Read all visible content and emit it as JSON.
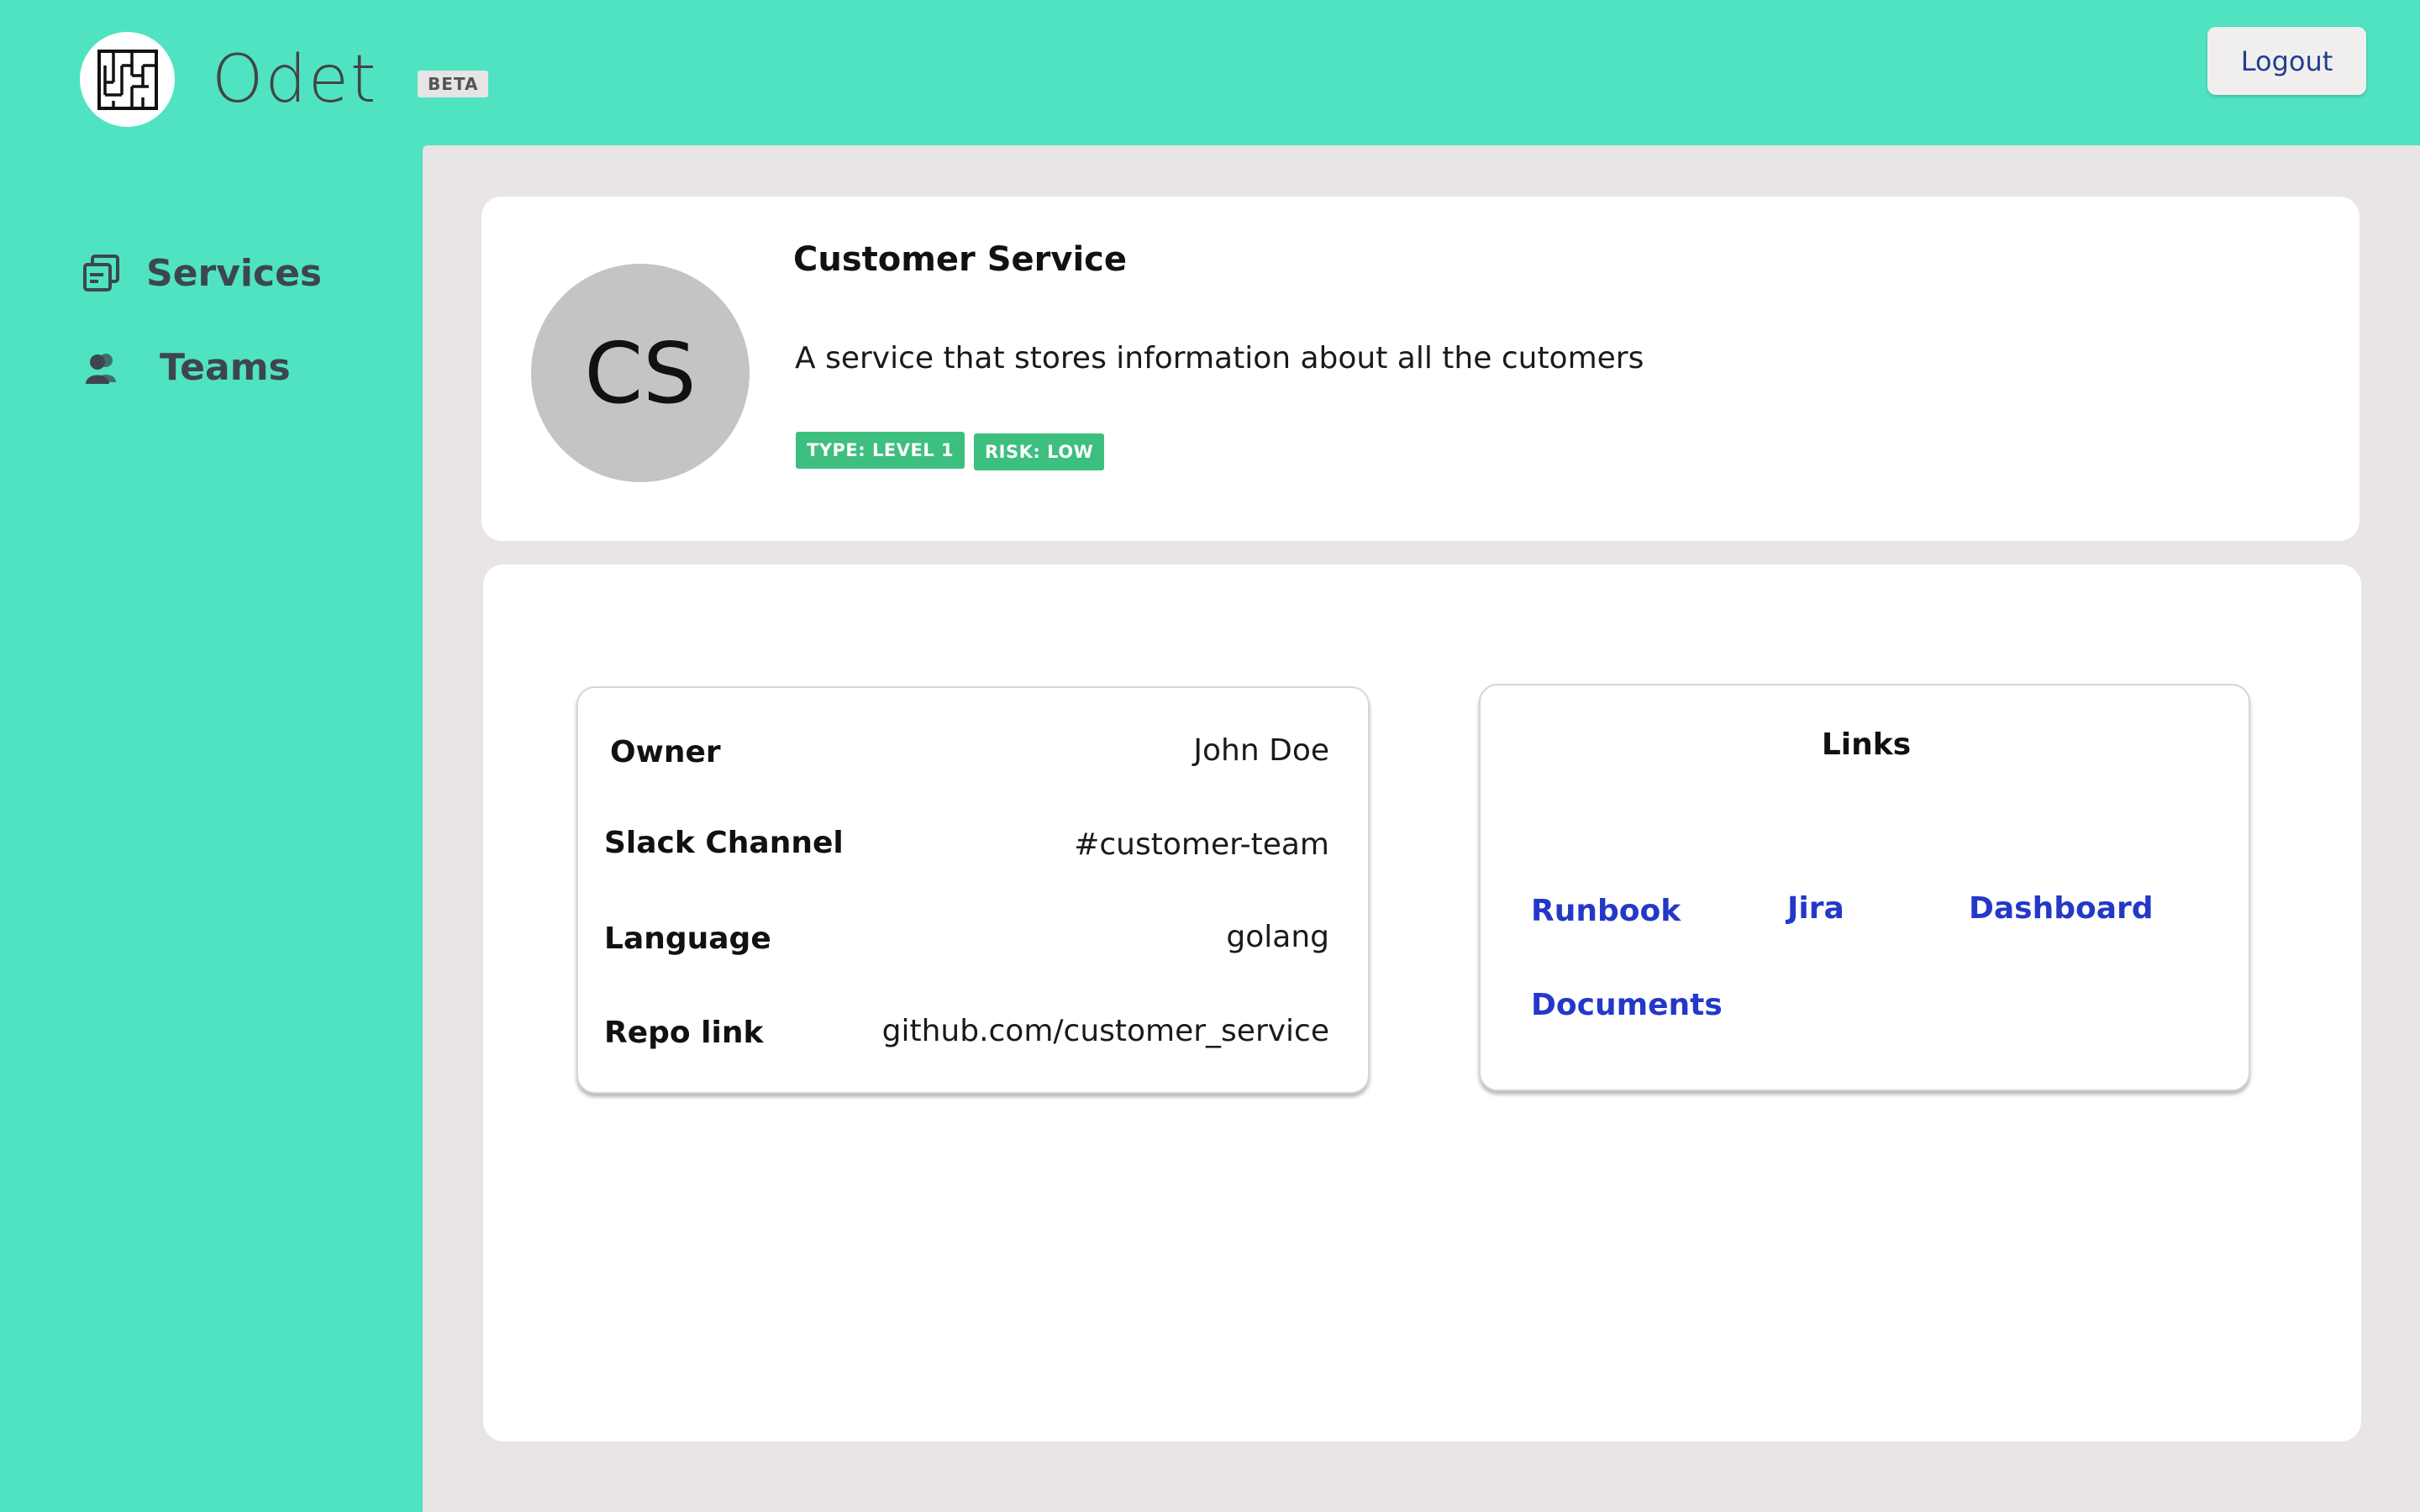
{
  "app": {
    "name": "Odet",
    "badge": "BETA",
    "logout_label": "Logout"
  },
  "sidebar": {
    "items": [
      {
        "label": "Services",
        "icon": "services-icon"
      },
      {
        "label": "Teams",
        "icon": "teams-icon"
      }
    ]
  },
  "service": {
    "initials": "CS",
    "name": "Customer Service",
    "description": "A service that stores information about all the cutomers",
    "tags": [
      "TYPE: LEVEL 1",
      "RISK: LOW"
    ],
    "details": [
      {
        "label": "Owner",
        "value": "John Doe"
      },
      {
        "label": "Slack Channel",
        "value": "#customer-team"
      },
      {
        "label": "Language",
        "value": "golang"
      },
      {
        "label": "Repo link",
        "value": "github.com/customer_service"
      }
    ]
  },
  "links": {
    "title": "Links",
    "items": [
      "Runbook",
      "Jira",
      "Dashboard",
      "Documents"
    ]
  },
  "colors": {
    "background": "#50e3c2",
    "panel": "#e9e5e5",
    "tag": "#3dbf7f",
    "link": "#2438c8",
    "avatar": "#c4c4c4"
  }
}
